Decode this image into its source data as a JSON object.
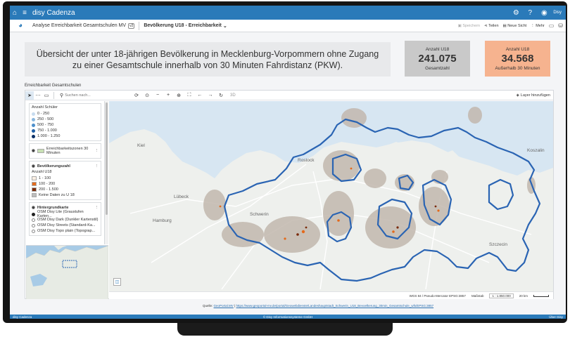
{
  "app": {
    "title": "disy Cadenza",
    "user": "Disy"
  },
  "nav": {
    "analysis": "Analyse Erreichbarkeit Gesamtschulen MV",
    "version": "v2",
    "report": "Bevölkerung U18 - Erreichbarkeit",
    "actions": {
      "save": "Speichern",
      "share": "Teilen",
      "new_view": "Neue Sicht",
      "more": "Mehr"
    }
  },
  "heading": "Übersicht der unter 18-jährigen Bevölkerung in Mecklenburg-Vorpommern ohne Zugang zu einer Gesamtschule innerhalb von 30 Minuten Fahrdistanz (PKW).",
  "kpis": [
    {
      "label": "Anzahl U18",
      "value": "241.075",
      "sub": "Gesamtzahl",
      "color": "#c9c9c9"
    },
    {
      "label": "Anzahl U18",
      "value": "34.568",
      "sub": "Außerhalb 30 Minuten",
      "color": "#f6b38f"
    }
  ],
  "widget": {
    "title": "Erreichbarkeit Gesamtschulen"
  },
  "map_toolbar": {
    "search_placeholder": "Suchen nach...",
    "label_3d": "3D",
    "add_layer": "Layer hinzufügen"
  },
  "legend": {
    "students": {
      "title": "Anzahl Schüler",
      "items": [
        {
          "label": "0 - 250",
          "color": "#c7dcef"
        },
        {
          "label": "250 - 500",
          "color": "#8ab7de"
        },
        {
          "label": "500 - 750",
          "color": "#4c8fcb"
        },
        {
          "label": "750 - 1.000",
          "color": "#1f5fa5"
        },
        {
          "label": "1.000 - 1.250",
          "color": "#0b2f66"
        }
      ]
    },
    "zones": {
      "title": "Erreichbarkeitszonen 30 Minuten",
      "color": "#c8e0b4"
    },
    "population": {
      "title": "Bevölkerungszahl",
      "subtitle": "Anzahl U18",
      "items": [
        {
          "label": "1 - 100",
          "color": "#fbefe3"
        },
        {
          "label": "100 - 200",
          "color": "#e36a1c"
        },
        {
          "label": "200 - 1.500",
          "color": "#7a2a0a"
        },
        {
          "label": "Keine Daten zu U 18",
          "color": "#bdbdbd"
        }
      ]
    },
    "basemap": {
      "title": "Hintergrundkarte",
      "items": [
        {
          "label": "OSM Disy Lite (Graustufen Karten...",
          "selected": true
        },
        {
          "label": "OSM Disy Dark (Dunkler Kartenstil)",
          "selected": false
        },
        {
          "label": "OSM Disy Streets (Standard-Ka...",
          "selected": false
        },
        {
          "label": "OSM Disy Topo plain (Topograp...",
          "selected": false
        }
      ]
    }
  },
  "map": {
    "cities": [
      "Kiel",
      "Rostock",
      "Lübeck",
      "Hamburg",
      "Schwerin",
      "Szczecin",
      "Koszalin"
    ],
    "boundary_color": "#2a64b3"
  },
  "statusbar": {
    "crs": "WGS 84 / Pseudo-Mercator EPSG:3857",
    "scale_label": "Maßstab",
    "scale_value": "1 : 1.850.000",
    "distance": "20 km"
  },
  "source": {
    "prefix": "Quelle:",
    "link1": "GeoPortal.MV",
    "separator": "|",
    "link2": "https://www.geoportal-mv.de/portal/Geowebdienste/Landeshauptstadt_Schwerin_U18_Bevoelkerung_30min_Gesamtschule_wfs/EPSG:3857"
  },
  "footer": {
    "left": "disy Cadenza",
    "center": "© Disy Informationssysteme GmbH",
    "right": "Über Disy"
  }
}
